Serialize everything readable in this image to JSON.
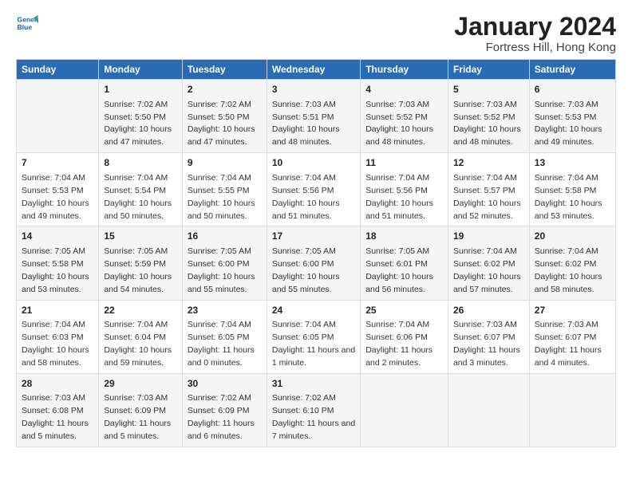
{
  "logo": {
    "line1": "General",
    "line2": "Blue"
  },
  "title": "January 2024",
  "subtitle": "Fortress Hill, Hong Kong",
  "columns": [
    "Sunday",
    "Monday",
    "Tuesday",
    "Wednesday",
    "Thursday",
    "Friday",
    "Saturday"
  ],
  "weeks": [
    [
      {
        "day": "",
        "sunrise": "",
        "sunset": "",
        "daylight": ""
      },
      {
        "day": "1",
        "sunrise": "Sunrise: 7:02 AM",
        "sunset": "Sunset: 5:50 PM",
        "daylight": "Daylight: 10 hours and 47 minutes."
      },
      {
        "day": "2",
        "sunrise": "Sunrise: 7:02 AM",
        "sunset": "Sunset: 5:50 PM",
        "daylight": "Daylight: 10 hours and 47 minutes."
      },
      {
        "day": "3",
        "sunrise": "Sunrise: 7:03 AM",
        "sunset": "Sunset: 5:51 PM",
        "daylight": "Daylight: 10 hours and 48 minutes."
      },
      {
        "day": "4",
        "sunrise": "Sunrise: 7:03 AM",
        "sunset": "Sunset: 5:52 PM",
        "daylight": "Daylight: 10 hours and 48 minutes."
      },
      {
        "day": "5",
        "sunrise": "Sunrise: 7:03 AM",
        "sunset": "Sunset: 5:52 PM",
        "daylight": "Daylight: 10 hours and 48 minutes."
      },
      {
        "day": "6",
        "sunrise": "Sunrise: 7:03 AM",
        "sunset": "Sunset: 5:53 PM",
        "daylight": "Daylight: 10 hours and 49 minutes."
      }
    ],
    [
      {
        "day": "7",
        "sunrise": "Sunrise: 7:04 AM",
        "sunset": "Sunset: 5:53 PM",
        "daylight": "Daylight: 10 hours and 49 minutes."
      },
      {
        "day": "8",
        "sunrise": "Sunrise: 7:04 AM",
        "sunset": "Sunset: 5:54 PM",
        "daylight": "Daylight: 10 hours and 50 minutes."
      },
      {
        "day": "9",
        "sunrise": "Sunrise: 7:04 AM",
        "sunset": "Sunset: 5:55 PM",
        "daylight": "Daylight: 10 hours and 50 minutes."
      },
      {
        "day": "10",
        "sunrise": "Sunrise: 7:04 AM",
        "sunset": "Sunset: 5:56 PM",
        "daylight": "Daylight: 10 hours and 51 minutes."
      },
      {
        "day": "11",
        "sunrise": "Sunrise: 7:04 AM",
        "sunset": "Sunset: 5:56 PM",
        "daylight": "Daylight: 10 hours and 51 minutes."
      },
      {
        "day": "12",
        "sunrise": "Sunrise: 7:04 AM",
        "sunset": "Sunset: 5:57 PM",
        "daylight": "Daylight: 10 hours and 52 minutes."
      },
      {
        "day": "13",
        "sunrise": "Sunrise: 7:04 AM",
        "sunset": "Sunset: 5:58 PM",
        "daylight": "Daylight: 10 hours and 53 minutes."
      }
    ],
    [
      {
        "day": "14",
        "sunrise": "Sunrise: 7:05 AM",
        "sunset": "Sunset: 5:58 PM",
        "daylight": "Daylight: 10 hours and 53 minutes."
      },
      {
        "day": "15",
        "sunrise": "Sunrise: 7:05 AM",
        "sunset": "Sunset: 5:59 PM",
        "daylight": "Daylight: 10 hours and 54 minutes."
      },
      {
        "day": "16",
        "sunrise": "Sunrise: 7:05 AM",
        "sunset": "Sunset: 6:00 PM",
        "daylight": "Daylight: 10 hours and 55 minutes."
      },
      {
        "day": "17",
        "sunrise": "Sunrise: 7:05 AM",
        "sunset": "Sunset: 6:00 PM",
        "daylight": "Daylight: 10 hours and 55 minutes."
      },
      {
        "day": "18",
        "sunrise": "Sunrise: 7:05 AM",
        "sunset": "Sunset: 6:01 PM",
        "daylight": "Daylight: 10 hours and 56 minutes."
      },
      {
        "day": "19",
        "sunrise": "Sunrise: 7:04 AM",
        "sunset": "Sunset: 6:02 PM",
        "daylight": "Daylight: 10 hours and 57 minutes."
      },
      {
        "day": "20",
        "sunrise": "Sunrise: 7:04 AM",
        "sunset": "Sunset: 6:02 PM",
        "daylight": "Daylight: 10 hours and 58 minutes."
      }
    ],
    [
      {
        "day": "21",
        "sunrise": "Sunrise: 7:04 AM",
        "sunset": "Sunset: 6:03 PM",
        "daylight": "Daylight: 10 hours and 58 minutes."
      },
      {
        "day": "22",
        "sunrise": "Sunrise: 7:04 AM",
        "sunset": "Sunset: 6:04 PM",
        "daylight": "Daylight: 10 hours and 59 minutes."
      },
      {
        "day": "23",
        "sunrise": "Sunrise: 7:04 AM",
        "sunset": "Sunset: 6:05 PM",
        "daylight": "Daylight: 11 hours and 0 minutes."
      },
      {
        "day": "24",
        "sunrise": "Sunrise: 7:04 AM",
        "sunset": "Sunset: 6:05 PM",
        "daylight": "Daylight: 11 hours and 1 minute."
      },
      {
        "day": "25",
        "sunrise": "Sunrise: 7:04 AM",
        "sunset": "Sunset: 6:06 PM",
        "daylight": "Daylight: 11 hours and 2 minutes."
      },
      {
        "day": "26",
        "sunrise": "Sunrise: 7:03 AM",
        "sunset": "Sunset: 6:07 PM",
        "daylight": "Daylight: 11 hours and 3 minutes."
      },
      {
        "day": "27",
        "sunrise": "Sunrise: 7:03 AM",
        "sunset": "Sunset: 6:07 PM",
        "daylight": "Daylight: 11 hours and 4 minutes."
      }
    ],
    [
      {
        "day": "28",
        "sunrise": "Sunrise: 7:03 AM",
        "sunset": "Sunset: 6:08 PM",
        "daylight": "Daylight: 11 hours and 5 minutes."
      },
      {
        "day": "29",
        "sunrise": "Sunrise: 7:03 AM",
        "sunset": "Sunset: 6:09 PM",
        "daylight": "Daylight: 11 hours and 5 minutes."
      },
      {
        "day": "30",
        "sunrise": "Sunrise: 7:02 AM",
        "sunset": "Sunset: 6:09 PM",
        "daylight": "Daylight: 11 hours and 6 minutes."
      },
      {
        "day": "31",
        "sunrise": "Sunrise: 7:02 AM",
        "sunset": "Sunset: 6:10 PM",
        "daylight": "Daylight: 11 hours and 7 minutes."
      },
      {
        "day": "",
        "sunrise": "",
        "sunset": "",
        "daylight": ""
      },
      {
        "day": "",
        "sunrise": "",
        "sunset": "",
        "daylight": ""
      },
      {
        "day": "",
        "sunrise": "",
        "sunset": "",
        "daylight": ""
      }
    ]
  ]
}
